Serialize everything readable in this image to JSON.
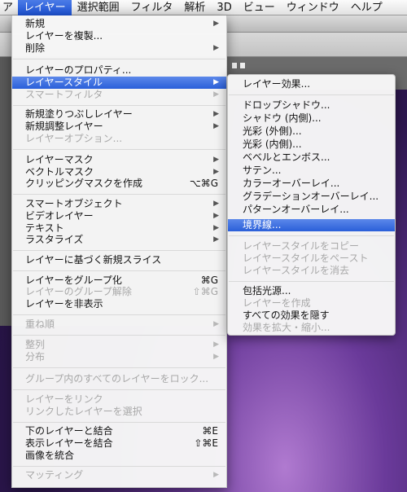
{
  "menubar": {
    "items": [
      {
        "label": "ア"
      },
      {
        "label": "レイヤー",
        "active": true
      },
      {
        "label": "選択範囲"
      },
      {
        "label": "フィルタ"
      },
      {
        "label": "解析"
      },
      {
        "label": "3D"
      },
      {
        "label": "ビュー"
      },
      {
        "label": "ウィンドウ"
      },
      {
        "label": "ヘルプ"
      }
    ]
  },
  "layer_menu": {
    "items": [
      {
        "label": "新規",
        "submenu": true
      },
      {
        "label": "レイヤーを複製..."
      },
      {
        "label": "削除",
        "submenu": true
      },
      {
        "label": "レイヤーのプロパティ..."
      },
      {
        "label": "レイヤースタイル",
        "submenu": true,
        "selected": true
      },
      {
        "label": "スマートフィルタ",
        "submenu": true,
        "disabled": true
      },
      {
        "label": "新規塗りつぶしレイヤー",
        "submenu": true
      },
      {
        "label": "新規調整レイヤー",
        "submenu": true
      },
      {
        "label": "レイヤーオプション...",
        "disabled": true
      },
      {
        "label": "レイヤーマスク",
        "submenu": true
      },
      {
        "label": "ベクトルマスク",
        "submenu": true
      },
      {
        "label": "クリッピングマスクを作成",
        "shortcut": "⌥⌘G"
      },
      {
        "label": "スマートオブジェクト",
        "submenu": true
      },
      {
        "label": "ビデオレイヤー",
        "submenu": true
      },
      {
        "label": "テキスト",
        "submenu": true
      },
      {
        "label": "ラスタライズ",
        "submenu": true
      },
      {
        "label": "レイヤーに基づく新規スライス"
      },
      {
        "label": "レイヤーをグループ化",
        "shortcut": "⌘G"
      },
      {
        "label": "レイヤーのグループ解除",
        "shortcut": "⇧⌘G",
        "disabled": true
      },
      {
        "label": "レイヤーを非表示"
      },
      {
        "label": "重ね順",
        "submenu": true,
        "disabled": true
      },
      {
        "label": "整列",
        "submenu": true,
        "disabled": true
      },
      {
        "label": "分布",
        "submenu": true,
        "disabled": true
      },
      {
        "label": "グループ内のすべてのレイヤーをロック...",
        "disabled": true
      },
      {
        "label": "レイヤーをリンク",
        "disabled": true
      },
      {
        "label": "リンクしたレイヤーを選択",
        "disabled": true
      },
      {
        "label": "下のレイヤーと結合",
        "shortcut": "⌘E"
      },
      {
        "label": "表示レイヤーを結合",
        "shortcut": "⇧⌘E"
      },
      {
        "label": "画像を統合"
      },
      {
        "label": "マッティング",
        "submenu": true,
        "disabled": true
      }
    ]
  },
  "style_submenu": {
    "items": [
      {
        "label": "レイヤー効果..."
      },
      {
        "label": "ドロップシャドウ..."
      },
      {
        "label": "シャドウ (内側)..."
      },
      {
        "label": "光彩 (外側)..."
      },
      {
        "label": "光彩 (内側)..."
      },
      {
        "label": "ベベルとエンボス..."
      },
      {
        "label": "サテン..."
      },
      {
        "label": "カラーオーバーレイ..."
      },
      {
        "label": "グラデーションオーバーレイ..."
      },
      {
        "label": "パターンオーバーレイ..."
      },
      {
        "label": "境界線...",
        "selected": true
      },
      {
        "label": "レイヤースタイルをコピー",
        "disabled": true
      },
      {
        "label": "レイヤースタイルをペースト",
        "disabled": true
      },
      {
        "label": "レイヤースタイルを消去",
        "disabled": true
      },
      {
        "label": "包括光源..."
      },
      {
        "label": "レイヤーを作成",
        "disabled": true
      },
      {
        "label": "すべての効果を隠す"
      },
      {
        "label": "効果を拡大・縮小...",
        "disabled": true
      }
    ]
  },
  "colors": {
    "highlight": "#2a5fd9",
    "disabled_text": "#a8a8a8"
  }
}
